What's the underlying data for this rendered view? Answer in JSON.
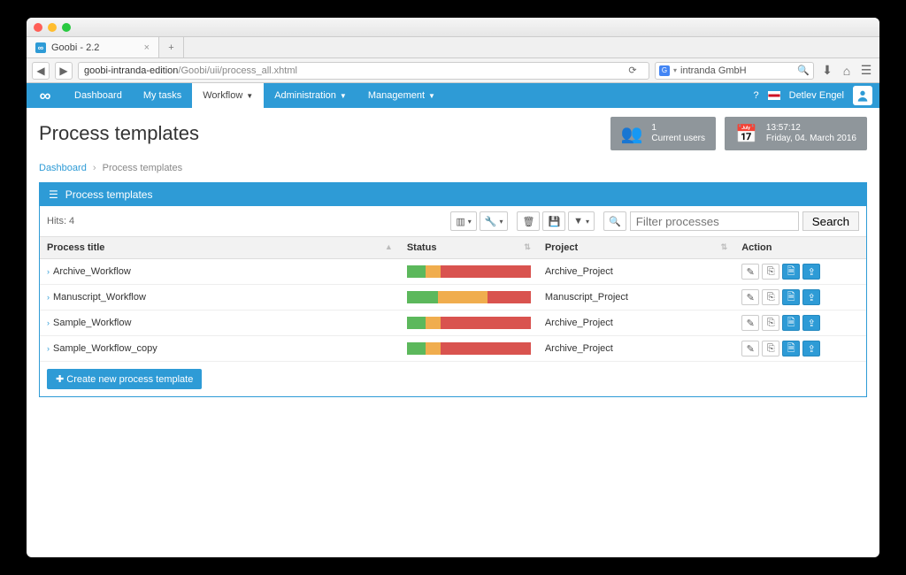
{
  "browser": {
    "tab_title": "Goobi - 2.2",
    "url_host": "goobi-intranda-edition",
    "url_path": "/Goobi/uii/process_all.xhtml",
    "search_engine": "intranda GmbH"
  },
  "nav": {
    "items": [
      "Dashboard",
      "My tasks",
      "Workflow",
      "Administration",
      "Management"
    ],
    "active_index": 2,
    "user": "Detlev Engel"
  },
  "header": {
    "title": "Process templates",
    "users_count": "1",
    "users_label": "Current users",
    "time": "13:57:12",
    "date": "Friday, 04. March 2016"
  },
  "breadcrumb": {
    "root": "Dashboard",
    "current": "Process templates"
  },
  "panel": {
    "title": "Process templates",
    "hits": "Hits: 4",
    "filter_placeholder": "Filter processes",
    "search_label": "Search",
    "columns": {
      "title": "Process title",
      "status": "Status",
      "project": "Project",
      "action": "Action"
    },
    "rows": [
      {
        "title": "Archive_Workflow",
        "project": "Archive_Project",
        "segments": [
          15,
          12,
          73
        ]
      },
      {
        "title": "Manuscript_Workflow",
        "project": "Manuscript_Project",
        "segments": [
          25,
          40,
          35
        ]
      },
      {
        "title": "Sample_Workflow",
        "project": "Archive_Project",
        "segments": [
          15,
          12,
          73
        ]
      },
      {
        "title": "Sample_Workflow_copy",
        "project": "Archive_Project",
        "segments": [
          15,
          12,
          73
        ]
      }
    ],
    "create_label": "Create new process template"
  }
}
